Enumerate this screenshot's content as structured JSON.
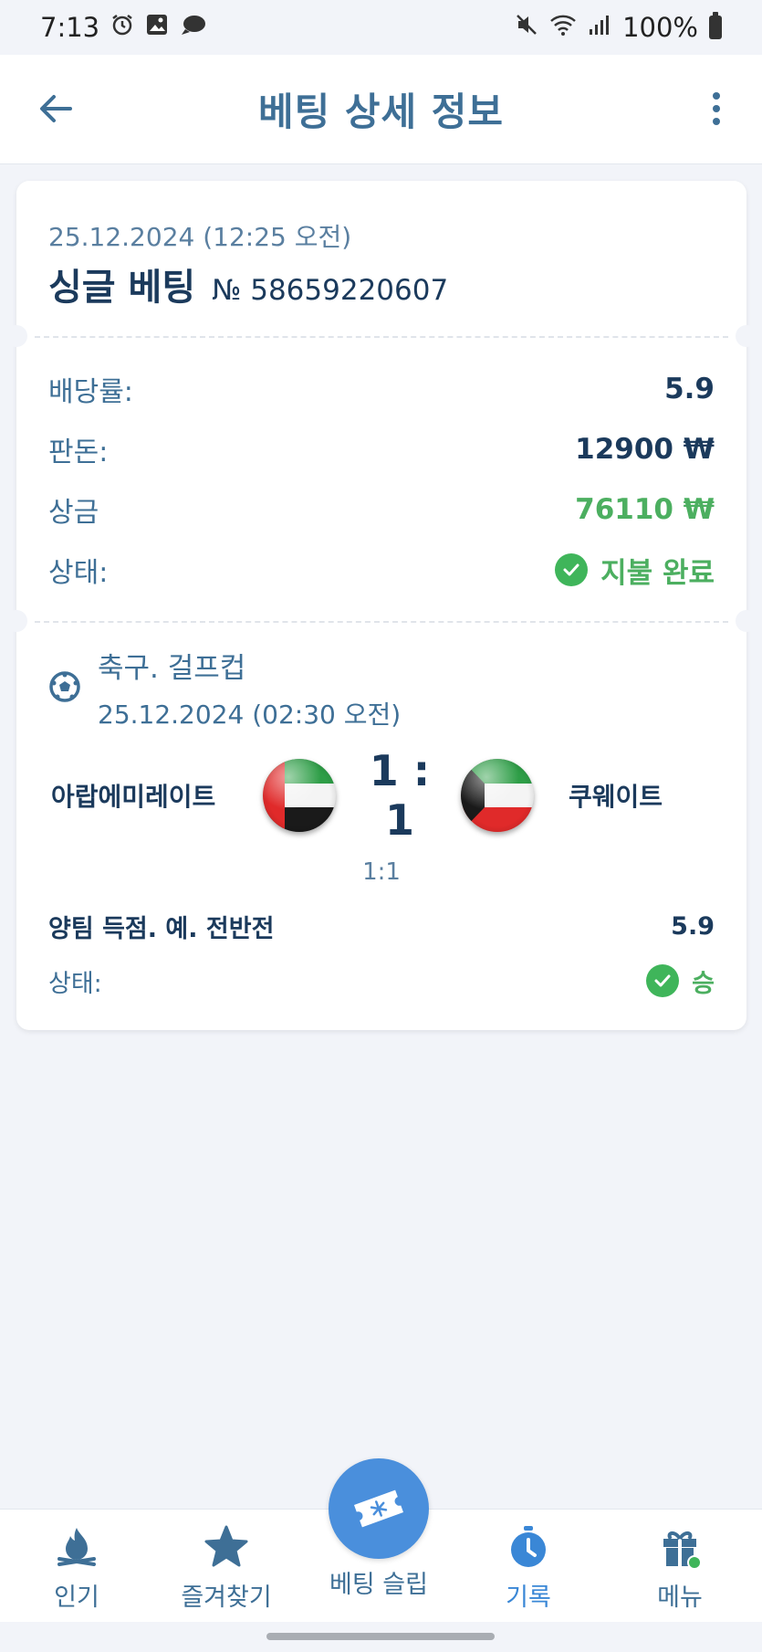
{
  "status_bar": {
    "time": "7:13",
    "battery": "100%",
    "icons_left": [
      "alarm-icon",
      "gallery-icon",
      "chat-icon"
    ],
    "icons_right": [
      "mute-icon",
      "wifi-icon",
      "signal-icon",
      "battery-icon"
    ]
  },
  "header": {
    "title": "베팅 상세 정보",
    "back_icon": "arrow-left-icon",
    "more_icon": "more-vertical-icon"
  },
  "bet": {
    "date": "25.12.2024 (12:25 오전)",
    "type": "싱글 베팅",
    "number": "№ 58659220607",
    "rows": {
      "odds_label": "배당률:",
      "odds_value": "5.9",
      "stake_label": "판돈:",
      "stake_value": "12900 ₩",
      "prize_label": "상금",
      "prize_value": "76110 ₩",
      "status_label": "상태:",
      "status_value": "지불 완료"
    }
  },
  "event": {
    "league": "축구. 걸프컵",
    "date": "25.12.2024 (02:30 오전)",
    "home_team": "아랍에미레이트",
    "away_team": "쿠웨이트",
    "score": "1 : 1",
    "half_score": "1:1",
    "market": "양팀 득점. 예. 전반전",
    "market_odds": "5.9",
    "status_label": "상태:",
    "status_value": "승"
  },
  "colors": {
    "accent": "#3e6f96",
    "primary_text": "#1b3a5c",
    "success": "#4caf60",
    "fab": "#4a8fdc",
    "background": "#f2f4f9"
  },
  "nav": {
    "items": [
      {
        "label": "인기",
        "icon": "fire-icon"
      },
      {
        "label": "즐겨찾기",
        "icon": "star-icon"
      },
      {
        "label": "베팅 슬립",
        "icon": "ticket-icon"
      },
      {
        "label": "기록",
        "icon": "stopwatch-icon"
      },
      {
        "label": "메뉴",
        "icon": "gift-icon"
      }
    ]
  }
}
